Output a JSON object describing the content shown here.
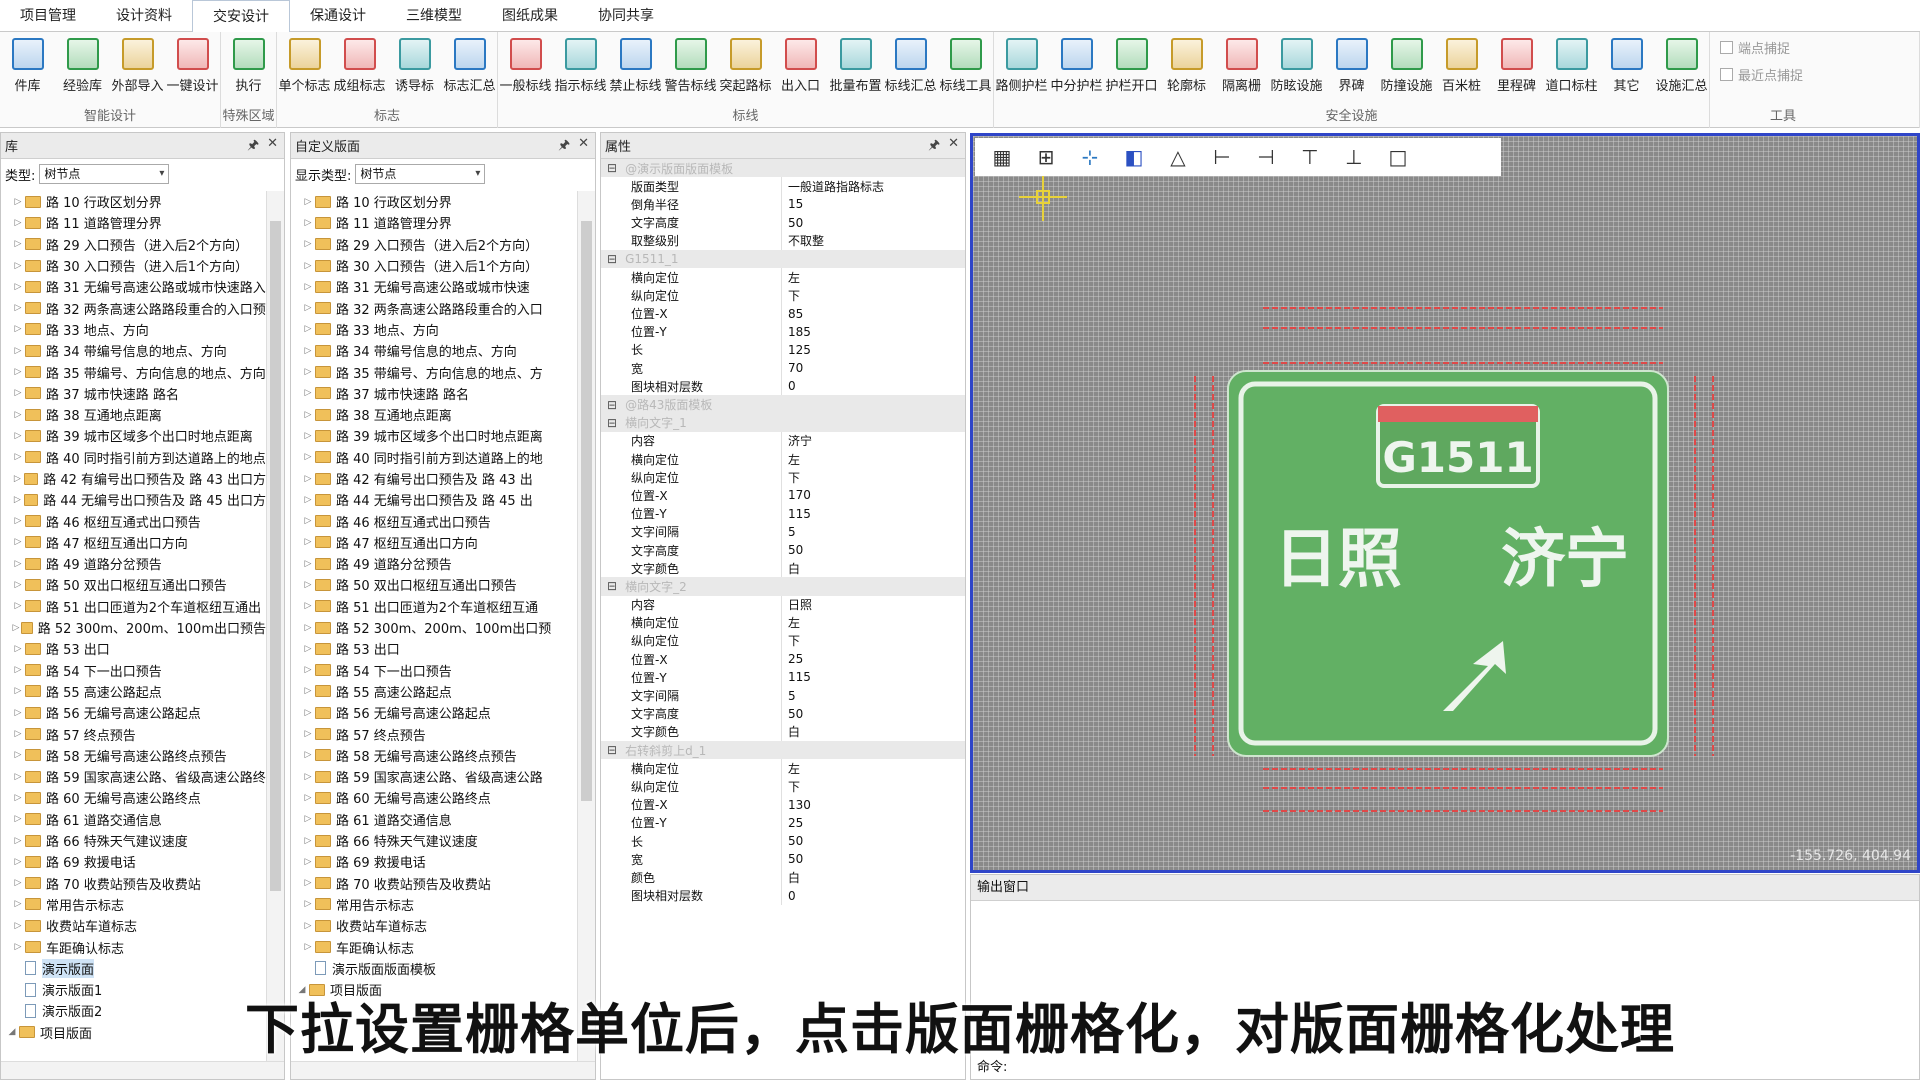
{
  "menu": {
    "tabs": [
      "项目管理",
      "设计资料",
      "交安设计",
      "保通设计",
      "三维模型",
      "图纸成果",
      "协同共享"
    ],
    "active": 2
  },
  "ribbon": {
    "groups": [
      {
        "name": "智能设计",
        "items": [
          "件库",
          "经验库",
          "外部导入",
          "一键设计"
        ]
      },
      {
        "name": "特殊区域",
        "items": [
          "执行"
        ]
      },
      {
        "name": "标志",
        "items": [
          "单个标志",
          "成组标志",
          "诱导标",
          "标志汇总"
        ]
      },
      {
        "name": "标线",
        "items": [
          "一般标线",
          "指示标线",
          "禁止标线",
          "警告标线",
          "突起路标",
          "出入口",
          "批量布置",
          "标线汇总",
          "标线工具"
        ]
      },
      {
        "name": "安全设施",
        "items": [
          "路侧护栏",
          "中分护栏",
          "护栏开口",
          "轮廓标",
          "隔离栅",
          "防眩设施",
          "界碑",
          "防撞设施",
          "百米桩",
          "里程碑",
          "道口标柱",
          "其它",
          "设施汇总"
        ]
      }
    ],
    "tools": {
      "name": "工具",
      "captures": [
        "端点捕捉",
        "最近点捕捉"
      ]
    }
  },
  "leftPanel": {
    "title": "库",
    "filterLabel": "类型:",
    "filterValue": "树节点",
    "pin": "🖈",
    "close": "✕",
    "items": [
      "路 10 行政区划分界",
      "路 11 道路管理分界",
      "路 29 入口预告（进入后2个方向）",
      "路 30 入口预告（进入后1个方向）",
      "路 31 无编号高速公路或城市快速路入",
      "路 32 两条高速公路路段重合的入口预",
      "路 33 地点、方向",
      "路 34 带编号信息的地点、方向",
      "路 35 带编号、方向信息的地点、方向",
      "路 37 城市快速路 路名",
      "路 38 互通地点距离",
      "路 39 城市区域多个出口时地点距离",
      "路 40 同时指引前方到达道路上的地点",
      "路 42 有编号出口预告及 路 43 出口方",
      "路 44 无编号出口预告及 路 45 出口方",
      "路 46 枢纽互通式出口预告",
      "路 47 枢纽互通出口方向",
      "路 49 道路分岔预告",
      "路 50 双出口枢纽互通出口预告",
      "路 51 出口匝道为2个车道枢纽互通出",
      "路 52 300m、200m、100m出口预告",
      "路 53 出口",
      "路 54 下一出口预告",
      "路 55 高速公路起点",
      "路 56 无编号高速公路起点",
      "路 57 终点预告",
      "路 58 无编号高速公路终点预告",
      "路 59 国家高速公路、省级高速公路终",
      "路 60 无编号高速公路终点",
      "路 61 道路交通信息",
      "路 66 特殊天气建议速度",
      "路 69 救援电话",
      "路 70 收费站预告及收费站",
      "常用告示标志",
      "收费站车道标志",
      "车距确认标志"
    ],
    "docs": [
      "演示版面",
      "演示版面1",
      "演示版面2"
    ],
    "root": "项目版面"
  },
  "midPanel": {
    "title": "自定义版面",
    "filterLabel": "显示类型:",
    "filterValue": "树节点",
    "pin": "🖈",
    "close": "✕",
    "items": [
      "路 10 行政区划分界",
      "路 11 道路管理分界",
      "路 29 入口预告（进入后2个方向）",
      "路 30 入口预告（进入后1个方向）",
      "路 31 无编号高速公路或城市快速",
      "路 32 两条高速公路路段重合的入口",
      "路 33 地点、方向",
      "路 34 带编号信息的地点、方向",
      "路 35 带编号、方向信息的地点、方",
      "路 37 城市快速路 路名",
      "路 38 互通地点距离",
      "路 39 城市区域多个出口时地点距离",
      "路 40 同时指引前方到达道路上的地",
      "路 42 有编号出口预告及 路 43 出",
      "路 44 无编号出口预告及 路 45 出",
      "路 46 枢纽互通式出口预告",
      "路 47 枢纽互通出口方向",
      "路 49 道路分岔预告",
      "路 50 双出口枢纽互通出口预告",
      "路 51 出口匝道为2个车道枢纽互通",
      "路 52 300m、200m、100m出口预",
      "路 53 出口",
      "路 54 下一出口预告",
      "路 55 高速公路起点",
      "路 56 无编号高速公路起点",
      "路 57 终点预告",
      "路 58 无编号高速公路终点预告",
      "路 59 国家高速公路、省级高速公路",
      "路 60 无编号高速公路终点",
      "路 61 道路交通信息",
      "路 66 特殊天气建议速度",
      "路 69 救援电话",
      "路 70 收费站预告及收费站",
      "常用告示标志",
      "收费站车道标志",
      "车距确认标志"
    ],
    "docs": [
      "演示版面版面模板"
    ],
    "root": "项目版面"
  },
  "props": {
    "title": "属性",
    "pin": "🖈",
    "close": "✕",
    "rows": [
      {
        "t": "sec",
        "n": "@演示版面版面模板"
      },
      {
        "n": "版面类型",
        "v": "一般道路指路标志"
      },
      {
        "n": "倒角半径",
        "v": "15"
      },
      {
        "n": "文字高度",
        "v": "50"
      },
      {
        "n": "取整级别",
        "v": "不取整"
      },
      {
        "t": "sec",
        "n": "G1511_1"
      },
      {
        "n": "横向定位",
        "v": "左"
      },
      {
        "n": "纵向定位",
        "v": "下"
      },
      {
        "n": "位置-X",
        "v": "85"
      },
      {
        "n": "位置-Y",
        "v": "185"
      },
      {
        "n": "长",
        "v": "125"
      },
      {
        "n": "宽",
        "v": "70"
      },
      {
        "n": "图块相对层数",
        "v": "0"
      },
      {
        "t": "sec",
        "n": "@路43版面模板"
      },
      {
        "t": "sec",
        "n": "横向文字_1"
      },
      {
        "n": "内容",
        "v": "济宁"
      },
      {
        "n": "横向定位",
        "v": "左"
      },
      {
        "n": "纵向定位",
        "v": "下"
      },
      {
        "n": "位置-X",
        "v": "170"
      },
      {
        "n": "位置-Y",
        "v": "115"
      },
      {
        "n": "文字间隔",
        "v": "5"
      },
      {
        "n": "文字高度",
        "v": "50"
      },
      {
        "n": "文字颜色",
        "v": "白"
      },
      {
        "t": "sec",
        "n": "横向文字_2"
      },
      {
        "n": "内容",
        "v": "日照"
      },
      {
        "n": "横向定位",
        "v": "左"
      },
      {
        "n": "纵向定位",
        "v": "下"
      },
      {
        "n": "位置-X",
        "v": "25"
      },
      {
        "n": "位置-Y",
        "v": "115"
      },
      {
        "n": "文字间隔",
        "v": "5"
      },
      {
        "n": "文字高度",
        "v": "50"
      },
      {
        "n": "文字颜色",
        "v": "白"
      },
      {
        "t": "sec",
        "n": "右转斜剪上d_1"
      },
      {
        "n": "横向定位",
        "v": "左"
      },
      {
        "n": "纵向定位",
        "v": "下"
      },
      {
        "n": "位置-X",
        "v": "130"
      },
      {
        "n": "位置-Y",
        "v": "25"
      },
      {
        "n": "长",
        "v": "50"
      },
      {
        "n": "宽",
        "v": "50"
      },
      {
        "n": "颜色",
        "v": "白"
      },
      {
        "n": "图块相对层数",
        "v": "0"
      }
    ]
  },
  "canvas": {
    "sign": {
      "route": "G1511",
      "left": "日照",
      "right": "济宁",
      "bg": "#5fae5f"
    },
    "coords": "-155.726, 404.94"
  },
  "output": {
    "title": "输出窗口",
    "cmd": "命令:"
  },
  "subtitle": "下拉设置栅格单位后，点击版面栅格化，对版面栅格化处理"
}
